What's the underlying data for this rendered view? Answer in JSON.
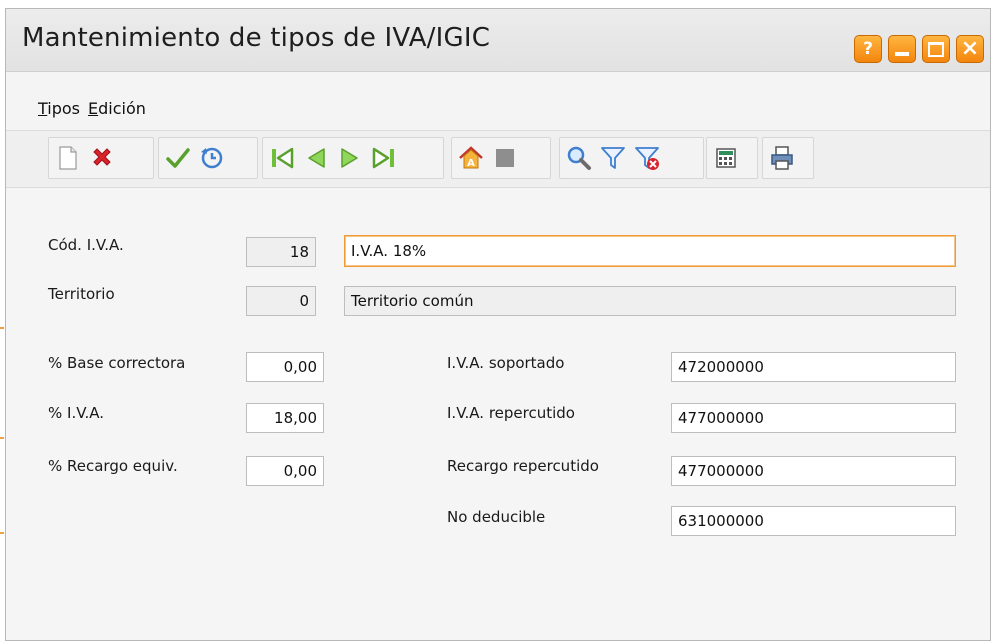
{
  "window": {
    "title": "Mantenimiento de tipos de IVA/IGIC",
    "buttons": {
      "help": "?",
      "close": "×"
    }
  },
  "menu": [
    {
      "first": "T",
      "rest": "ipos"
    },
    {
      "first": "E",
      "rest": "dición"
    }
  ],
  "toolbar": {
    "groups": [
      [
        "new-document-icon",
        "delete-icon"
      ],
      [
        "confirm-check-icon",
        "undo-icon"
      ],
      [
        "first-record-icon",
        "previous-record-icon",
        "next-record-icon",
        "last-record-icon"
      ],
      [
        "home-icon",
        "stop-icon"
      ],
      [
        "search-icon",
        "filter-icon",
        "remove-filter-icon"
      ],
      [
        "calculator-icon"
      ],
      [
        "print-icon"
      ]
    ]
  },
  "form": {
    "cod_iva": {
      "label": "Cód. I.V.A.",
      "code": "18",
      "description": "I.V.A. 18%"
    },
    "territorio": {
      "label": "Territorio",
      "code": "0",
      "description": "Territorio común"
    },
    "base_correctora": {
      "label": "% Base correctora",
      "value": "0,00"
    },
    "iva": {
      "label": "% I.V.A.",
      "value": "18,00"
    },
    "recargo": {
      "label": "% Recargo equiv.",
      "value": "0,00"
    },
    "iva_soportado": {
      "label": "I.V.A. soportado",
      "value": "472000000"
    },
    "iva_repercutido": {
      "label": "I.V.A. repercutido",
      "value": "477000000"
    },
    "recargo_repercutido": {
      "label": "Recargo repercutido",
      "value": "477000000"
    },
    "no_deducible": {
      "label": "No deducible",
      "value": "631000000"
    }
  },
  "colors": {
    "accent": "#f3850d",
    "focus_border": "#f09a34"
  }
}
